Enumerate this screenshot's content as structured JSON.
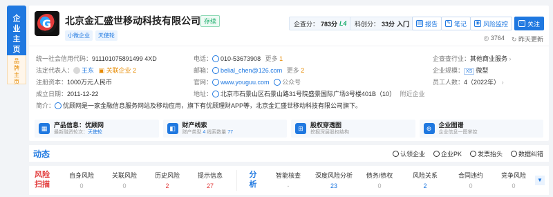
{
  "rail": {
    "main": [
      "企",
      "业",
      "主",
      "页"
    ],
    "sub": [
      "品",
      "牌",
      "主",
      "页"
    ]
  },
  "company": {
    "name": "北京金汇盛世移动科技有限公司",
    "status": "存续",
    "tags": [
      "小微企业",
      "天使轮"
    ]
  },
  "scores": {
    "qcc_label": "企查分：",
    "qcc_value": "783分",
    "qcc_level": "L4",
    "tech_label": "科创分：",
    "tech_value": "33分",
    "tech_level": "入门"
  },
  "actions": {
    "report": "报告",
    "notes": "笔记",
    "monitor": "风险监控",
    "follow": "关注"
  },
  "meta": {
    "views": "3764",
    "updated": "昨天更新"
  },
  "info": {
    "credit_code_label": "统一社会信用代码：",
    "credit_code": "911101075891499 4XD",
    "legal_rep_label": "法定代表人：",
    "legal_rep": "王东",
    "related_label": "关联企业",
    "related_count": "2",
    "capital_label": "注册资本：",
    "capital": "1000万元人民币",
    "founded_label": "成立日期：",
    "founded": "2011-12-22",
    "phone_label": "电话：",
    "phone": "010-53673908",
    "phone_more": "更多",
    "phone_more_count": "1",
    "email_label": "邮箱：",
    "email": "belial_chen@126.com",
    "email_more": "更多",
    "email_more_count": "2",
    "website_label": "官网：",
    "website": "www.youguu.com",
    "wechat": "公众号",
    "address_label": "地址：",
    "address": "北京市石景山区石景山路31号院盛景国际广场3号楼401B（10）",
    "address_extra": "附近企业",
    "industry_label": "企查查行业：",
    "industry": "其他商业服务",
    "scale_label": "企业规模：",
    "scale_badge": "XS",
    "scale": "微型",
    "staff_label": "员工人数：",
    "staff": "4",
    "staff_year": "（2022年）",
    "intro_label": "简介：",
    "intro": "优顾网是一家金融信息服务网站及移动应用，旗下有优顾理财APP等，北京金汇盛世移动科技有限公司旗下。"
  },
  "quick_cards": [
    {
      "icon": "product-icon",
      "title": "产品信息：优顾网",
      "sub1": "最新融资轮次：",
      "sub2": "天使轮"
    },
    {
      "icon": "asset-icon",
      "title": "财产线索",
      "sub1": "财产类型 ",
      "sub2": "4",
      "sub3": "  线索数量 ",
      "sub4": "77"
    },
    {
      "icon": "equity-icon",
      "title": "股权穿透图",
      "sub1": "挖掘深层股权结构"
    },
    {
      "icon": "graph-icon",
      "title": "企业图谱",
      "sub1": "企业信息一图掌控"
    }
  ],
  "dynamics": {
    "title": "动态",
    "tools": [
      "认领企业",
      "企业PK",
      "发票抬头",
      "数据纠错"
    ]
  },
  "risk": {
    "label_top": "风险",
    "label_bottom": "扫描",
    "items": [
      {
        "name": "自身风险",
        "value": "0"
      },
      {
        "name": "关联风险",
        "value": "0"
      },
      {
        "name": "历史风险",
        "value": "2"
      },
      {
        "name": "提示信息",
        "value": "27"
      }
    ]
  },
  "analysis": {
    "label_top": "分",
    "label_bottom": "析",
    "items": [
      {
        "name": "智能核查",
        "value": "-"
      },
      {
        "name": "深度风险分析",
        "value": "23"
      },
      {
        "name": "债务/债权",
        "value": "0"
      },
      {
        "name": "风险关系",
        "value": "2"
      },
      {
        "name": "合同违约",
        "value": "0"
      },
      {
        "name": "竞争风险",
        "value": "0"
      }
    ]
  },
  "colors": {
    "accent": "#1f78e0",
    "risk": "#e23b3b",
    "ok": "#1aad6b",
    "warn": "#e68a00"
  }
}
